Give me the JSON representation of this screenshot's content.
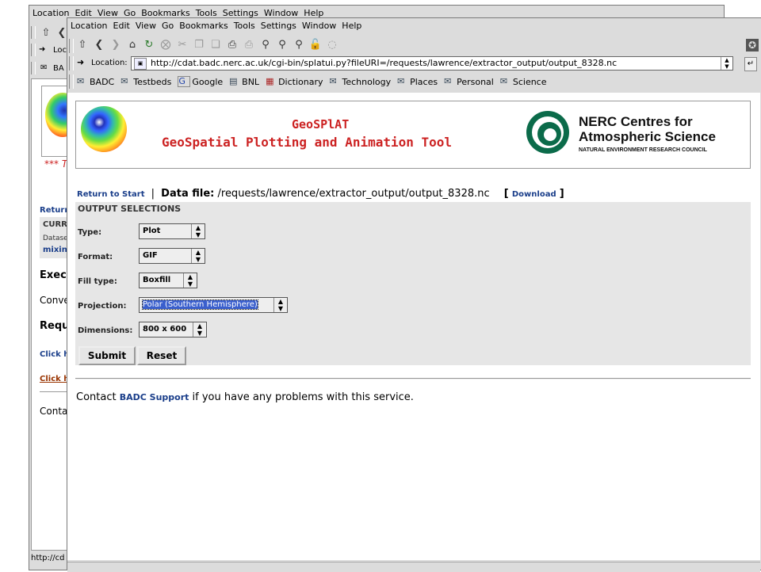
{
  "back_window": {
    "menu": [
      "Location",
      "Edit",
      "View",
      "Go",
      "Bookmarks",
      "Tools",
      "Settings",
      "Window",
      "Help"
    ],
    "loc_partial": "Loc",
    "bm_partial": "BA",
    "fragments": {
      "red_star": "*** T",
      "return": "Return",
      "curr": "CURR",
      "datase": "Datase",
      "mixing": "mixing",
      "exec": "Execu",
      "conv": "Conve",
      "requ": "Requ",
      "click1": "Click h",
      "click2": "Click h",
      "conta": "Conta",
      "status": "http://cd"
    }
  },
  "front_window": {
    "menu": [
      "Location",
      "Edit",
      "View",
      "Go",
      "Bookmarks",
      "Tools",
      "Settings",
      "Window",
      "Help"
    ],
    "location_label": "Location:",
    "url": "http://cdat.badc.nerc.ac.uk/cgi-bin/splatui.py?fileURI=/requests/lawrence/extractor_output/output_8328.nc",
    "bookmarks": [
      "BADC",
      "Testbeds",
      "Google",
      "BNL",
      "Dictionary",
      "Technology",
      "Places",
      "Personal",
      "Science"
    ]
  },
  "page": {
    "title": "GeoSPlAT",
    "subtitle": "GeoSpatial Plotting and Animation Tool",
    "nerc": {
      "line1": "NERC Centres for",
      "line2": "Atmospheric Science",
      "line3": "NATURAL ENVIRONMENT RESEARCH COUNCIL"
    },
    "return_link": "Return to Start",
    "sep": "|",
    "datafile_label": "Data file:",
    "datafile_path": "/requests/lawrence/extractor_output/output_8328.nc",
    "download_open": "[",
    "download_link": "Download",
    "download_close": "]",
    "section_title": "OUTPUT SELECTIONS",
    "fields": {
      "type": {
        "label": "Type:",
        "value": "Plot"
      },
      "format": {
        "label": "Format:",
        "value": "GIF"
      },
      "fill": {
        "label": "Fill type:",
        "value": "Boxfill"
      },
      "projection": {
        "label": "Projection:",
        "value": "Polar (Southern Hemisphere)"
      },
      "dimensions": {
        "label": "Dimensions:",
        "value": "800 x 600"
      }
    },
    "submit": "Submit",
    "reset": "Reset",
    "contact_prefix": "Contact",
    "contact_link": "BADC Support",
    "contact_suffix": "if you have any problems with this service."
  }
}
